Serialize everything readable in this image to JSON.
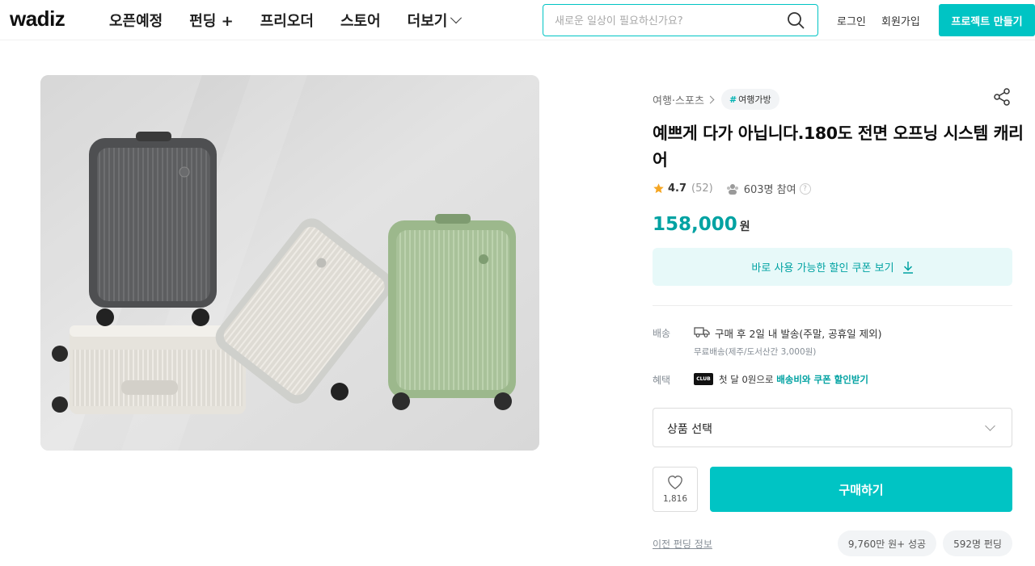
{
  "header": {
    "logo": "wadiz",
    "nav": [
      "오픈예정",
      "펀딩 +",
      "프리오더",
      "스토어",
      "더보기"
    ],
    "search_placeholder": "새로운 일상이 필요하신가요?",
    "login": "로그인",
    "signup": "회원가입",
    "make_project": "프로젝트 만들기",
    "accent_color": "#00c4c4"
  },
  "product": {
    "category": "여행·스포츠",
    "tag": "여행가방",
    "tag_hash": "#",
    "title": "예쁘게 다가 아닙니다.180도 전면 오프닝 시스템 캐리어",
    "rating": "4.7",
    "review_count": "(52)",
    "participants": "603명 참여",
    "price": "158,000",
    "price_unit": "원",
    "coupon_text": "바로 사용 가능한 할인 쿠폰 보기",
    "shipping_label": "배송",
    "shipping_main": "구매 후 2일 내 발송(주말, 공휴일 제외)",
    "shipping_sub": "무료배송(제주/도서산간 3,000원)",
    "benefit_label": "혜택",
    "club_badge": "CLUB",
    "benefit_prefix": "첫 달 0원으로 ",
    "benefit_highlight": "배송비와 쿠폰 할인받기",
    "option_select": "상품 선택",
    "like_count": "1,816",
    "buy_label": "구매하기",
    "prev_funding_link": "이전 펀딩 정보",
    "prev_amount": "9,760만 원+ 성공",
    "prev_supporters": "592명 펀딩"
  }
}
